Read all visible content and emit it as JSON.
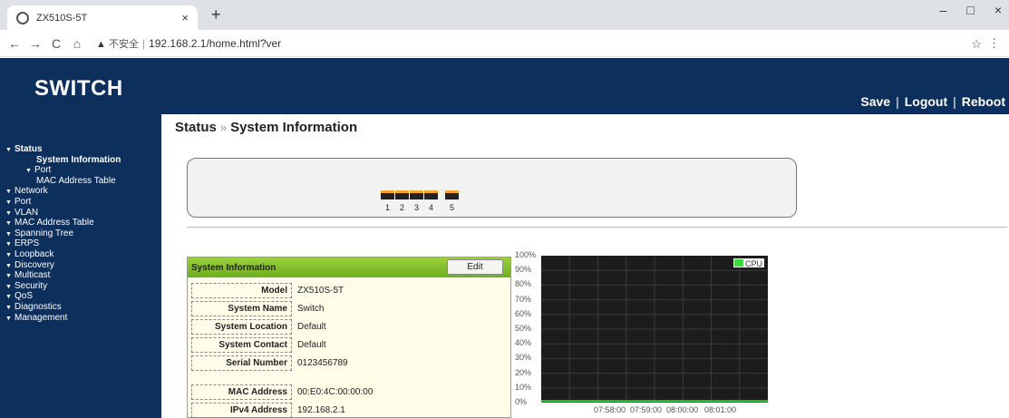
{
  "browser": {
    "tab_title": "ZX510S-5T",
    "tab_close": "×",
    "new_tab": "+",
    "minimize": "–",
    "maximize": "□",
    "close": "×",
    "back": "←",
    "forward": "→",
    "reload": "C",
    "home": "⌂",
    "insecure_icon": "▲",
    "insecure_label": "不安全",
    "url_sep": "|",
    "url": "192.168.2.1/home.html?ver",
    "bookmark": "☆",
    "menu": "⋮"
  },
  "header": {
    "logo": "SWITCH",
    "save": "Save",
    "logout": "Logout",
    "reboot": "Reboot",
    "sep": "|"
  },
  "sidebar": {
    "items": [
      {
        "label": "Status",
        "level": 1,
        "bold": true,
        "caret": true
      },
      {
        "label": "System Information",
        "level": 2,
        "bold": true,
        "caret": false
      },
      {
        "label": "Port",
        "level": 2,
        "bold": false,
        "caret": true
      },
      {
        "label": "MAC Address Table",
        "level": 2,
        "bold": false,
        "caret": false
      },
      {
        "label": "Network",
        "level": 1,
        "bold": false,
        "caret": true
      },
      {
        "label": "Port",
        "level": 1,
        "bold": false,
        "caret": true
      },
      {
        "label": "VLAN",
        "level": 1,
        "bold": false,
        "caret": true
      },
      {
        "label": "MAC Address Table",
        "level": 1,
        "bold": false,
        "caret": true
      },
      {
        "label": "Spanning Tree",
        "level": 1,
        "bold": false,
        "caret": true
      },
      {
        "label": "ERPS",
        "level": 1,
        "bold": false,
        "caret": true
      },
      {
        "label": "Loopback",
        "level": 1,
        "bold": false,
        "caret": true
      },
      {
        "label": "Discovery",
        "level": 1,
        "bold": false,
        "caret": true
      },
      {
        "label": "Multicast",
        "level": 1,
        "bold": false,
        "caret": true
      },
      {
        "label": "Security",
        "level": 1,
        "bold": false,
        "caret": true
      },
      {
        "label": "QoS",
        "level": 1,
        "bold": false,
        "caret": true
      },
      {
        "label": "Diagnostics",
        "level": 1,
        "bold": false,
        "caret": true
      },
      {
        "label": "Management",
        "level": 1,
        "bold": false,
        "caret": true
      }
    ]
  },
  "breadcrumb": {
    "section": "Status",
    "arrow": "»",
    "page": "System Information"
  },
  "ports": {
    "labels": [
      "1",
      "2",
      "3",
      "4",
      "5"
    ]
  },
  "info": {
    "title": "System Information",
    "edit": "Edit",
    "rows": [
      {
        "label": "Model",
        "value": "ZX510S-5T"
      },
      {
        "label": "System Name",
        "value": "Switch"
      },
      {
        "label": "System Location",
        "value": "Default"
      },
      {
        "label": "System Contact",
        "value": "Default"
      },
      {
        "label": "Serial Number",
        "value": "0123456789"
      },
      {
        "label": "MAC Address",
        "value": "00:E0:4C:00:00:00"
      },
      {
        "label": "IPv4 Address",
        "value": "192.168.2.1"
      }
    ]
  },
  "chart_data": {
    "type": "line",
    "title": "",
    "legend": "CPU",
    "legend_position": "top-right",
    "y_ticks": [
      "100%",
      "90%",
      "80%",
      "70%",
      "60%",
      "50%",
      "40%",
      "30%",
      "20%",
      "10%",
      "0%"
    ],
    "x_ticks": [
      "07:58:00",
      "07:59:00",
      "08:00:00",
      "08:01:00"
    ],
    "ylim": [
      0,
      100
    ],
    "grid": true,
    "series": [
      {
        "name": "CPU",
        "values": [
          1,
          1,
          1,
          1,
          1,
          1,
          1,
          1
        ]
      }
    ],
    "colors": {
      "background": "#1c1c1c",
      "grid": "#3a3a3a",
      "line": "#3ddc3d"
    }
  }
}
